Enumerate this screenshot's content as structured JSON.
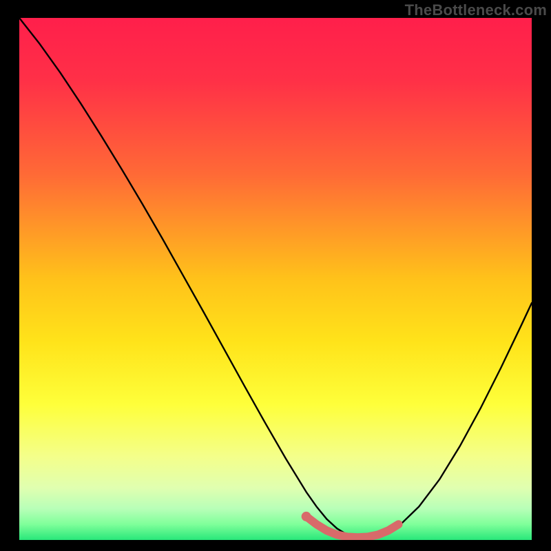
{
  "watermark": "TheBottleneck.com",
  "colors": {
    "bg": "#000000",
    "curve": "#000000",
    "highlight": "#d86a6a",
    "watermark": "#4a4a4a"
  },
  "chart_data": {
    "type": "line",
    "title": "",
    "xlabel": "",
    "ylabel": "",
    "xlim": [
      0,
      100
    ],
    "ylim": [
      0,
      100
    ],
    "gradient_stops": [
      {
        "offset": 0,
        "color": "#ff1f4b"
      },
      {
        "offset": 12,
        "color": "#ff3047"
      },
      {
        "offset": 30,
        "color": "#ff6a36"
      },
      {
        "offset": 50,
        "color": "#ffc21a"
      },
      {
        "offset": 62,
        "color": "#ffe31a"
      },
      {
        "offset": 74,
        "color": "#feff3a"
      },
      {
        "offset": 84,
        "color": "#f4ff8a"
      },
      {
        "offset": 90,
        "color": "#e0ffb0"
      },
      {
        "offset": 94,
        "color": "#b8ffb8"
      },
      {
        "offset": 97,
        "color": "#7fff9a"
      },
      {
        "offset": 100,
        "color": "#28e77a"
      }
    ],
    "series": [
      {
        "name": "bottleneck-curve",
        "x": [
          0,
          4,
          8,
          12,
          16,
          20,
          24,
          28,
          32,
          36,
          40,
          44,
          48,
          52,
          56,
          58,
          60,
          62,
          64,
          66,
          68,
          70,
          74,
          78,
          82,
          86,
          90,
          94,
          98,
          100
        ],
        "y": [
          100,
          95,
          89.5,
          83.6,
          77.4,
          71,
          64.4,
          57.6,
          50.6,
          43.6,
          36.5,
          29.4,
          22.4,
          15.6,
          9.2,
          6.4,
          4,
          2.2,
          1,
          0.4,
          0.2,
          0.6,
          2.6,
          6.4,
          11.6,
          18,
          25.2,
          33,
          41.2,
          45.4
        ]
      }
    ],
    "highlight_segment": {
      "comment": "pink stroke near the minimum of the curve",
      "x": [
        56,
        58,
        60,
        62,
        64,
        66,
        68,
        70,
        72,
        74
      ],
      "y": [
        4.5,
        3.0,
        1.8,
        1.0,
        0.6,
        0.5,
        0.6,
        1.0,
        1.8,
        3.0
      ]
    },
    "highlight_dot": {
      "x": 56,
      "y": 4.5
    }
  }
}
